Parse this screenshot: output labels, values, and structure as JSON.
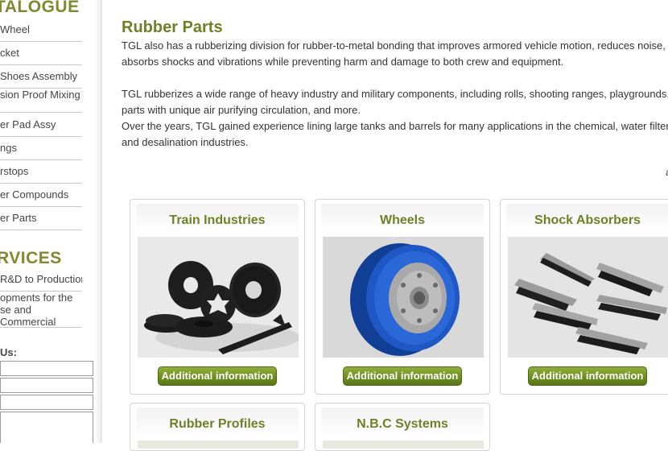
{
  "sidebar": {
    "catalogue_heading": "TALOGUE",
    "catalogue_items": [
      "Wheel",
      "cket",
      "Shoes Assembly",
      "sion Proof Mixing",
      "er Pad Assy",
      "ngs",
      "rstops",
      "er Compounds",
      "er Parts"
    ],
    "services_heading": "RVICES",
    "services_items": [
      "R&D to Production",
      "opments for the\nse and Commercial\ntries"
    ],
    "contact_label": "Us:"
  },
  "main": {
    "title": "Rubber Parts",
    "paragraphs": [
      "TGL also has a rubberizing division for rubber-to-metal bonding that improves armored vehicle motion, reduces noise,",
      "absorbs shocks and vibrations while preventing harm and damage to both crew and equipment.",
      "TGL rubberizes a wide range of heavy industry and military components, including rolls, shooting ranges, playgrounds,",
      "parts with unique air purifying circulation, and more.",
      "Over the years, TGL gained experience lining large tanks and barrels for many applications in the chemical, water filter",
      "and desalination industries."
    ],
    "stray_text": "a",
    "cards": [
      {
        "title": "Train Industries",
        "button": "Additional information",
        "image": "black-rubber-wheels-photo"
      },
      {
        "title": "Wheels",
        "button": "Additional information",
        "image": "blue-polyurethane-wheel-photo"
      },
      {
        "title": "Shock Absorbers",
        "button": "Additional information",
        "image": "rubber-metal-mounts-photo"
      },
      {
        "title": "Rubber Profiles",
        "button": "",
        "image": ""
      },
      {
        "title": "N.B.C Systems",
        "button": "",
        "image": ""
      }
    ]
  },
  "colors": {
    "accent_green": "#6b8227",
    "button_green": "#6f8f1f"
  }
}
